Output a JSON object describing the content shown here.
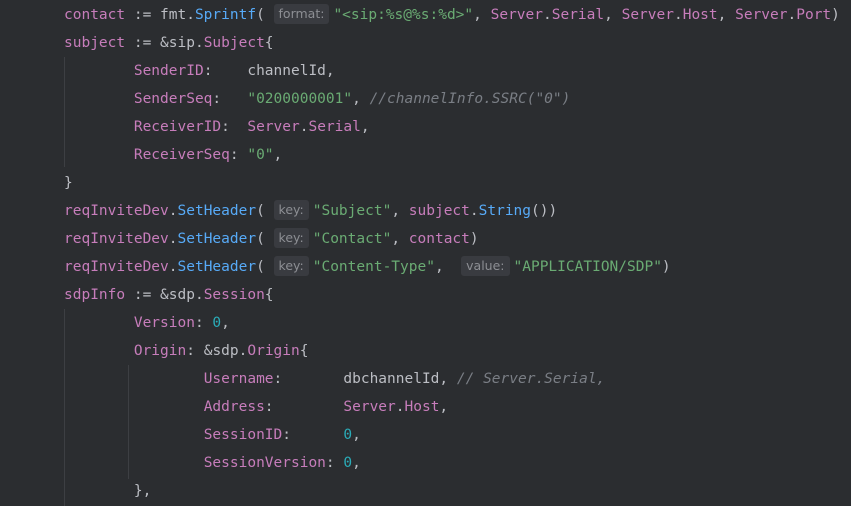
{
  "code_lines": [
    [
      {
        "c": "tk-var",
        "t": "contact"
      },
      {
        "c": "tk-op",
        "t": " := "
      },
      {
        "c": "tk-pkg",
        "t": "fmt."
      },
      {
        "c": "tk-fn",
        "t": "Sprintf"
      },
      {
        "c": "tk-punc",
        "t": "( "
      },
      {
        "c": "hint",
        "t": "format:"
      },
      {
        "c": "tk-str",
        "t": "\"<sip:%s@%s:%d>\""
      },
      {
        "c": "tk-punc",
        "t": ", "
      },
      {
        "c": "tk-var",
        "t": "Server"
      },
      {
        "c": "tk-punc",
        "t": "."
      },
      {
        "c": "tk-fld",
        "t": "Serial"
      },
      {
        "c": "tk-punc",
        "t": ", "
      },
      {
        "c": "tk-var",
        "t": "Server"
      },
      {
        "c": "tk-punc",
        "t": "."
      },
      {
        "c": "tk-fld",
        "t": "Host"
      },
      {
        "c": "tk-punc",
        "t": ", "
      },
      {
        "c": "tk-var",
        "t": "Server"
      },
      {
        "c": "tk-punc",
        "t": "."
      },
      {
        "c": "tk-fld",
        "t": "Port"
      },
      {
        "c": "tk-punc",
        "t": ")"
      }
    ],
    [
      {
        "c": "tk-var",
        "t": "subject"
      },
      {
        "c": "tk-op",
        "t": " := "
      },
      {
        "c": "tk-punc",
        "t": "&"
      },
      {
        "c": "tk-pkg",
        "t": "sip."
      },
      {
        "c": "tk-type",
        "t": "Subject"
      },
      {
        "c": "tk-punc",
        "t": "{"
      }
    ],
    [
      {
        "c": "tk-plain",
        "t": "        "
      },
      {
        "c": "tk-fld",
        "t": "SenderID"
      },
      {
        "c": "tk-punc",
        "t": ":    "
      },
      {
        "c": "tk-plain",
        "t": "channelId"
      },
      {
        "c": "tk-punc",
        "t": ","
      }
    ],
    [
      {
        "c": "tk-plain",
        "t": "        "
      },
      {
        "c": "tk-fld",
        "t": "SenderSeq"
      },
      {
        "c": "tk-punc",
        "t": ":   "
      },
      {
        "c": "tk-str",
        "t": "\"0200000001\""
      },
      {
        "c": "tk-punc",
        "t": ", "
      },
      {
        "c": "tk-cmt",
        "t": "//channelInfo.SSRC(\"0\")"
      }
    ],
    [
      {
        "c": "tk-plain",
        "t": "        "
      },
      {
        "c": "tk-fld",
        "t": "ReceiverID"
      },
      {
        "c": "tk-punc",
        "t": ":  "
      },
      {
        "c": "tk-var",
        "t": "Server"
      },
      {
        "c": "tk-punc",
        "t": "."
      },
      {
        "c": "tk-fld",
        "t": "Serial"
      },
      {
        "c": "tk-punc",
        "t": ","
      }
    ],
    [
      {
        "c": "tk-plain",
        "t": "        "
      },
      {
        "c": "tk-fld",
        "t": "ReceiverSeq"
      },
      {
        "c": "tk-punc",
        "t": ": "
      },
      {
        "c": "tk-str",
        "t": "\"0\""
      },
      {
        "c": "tk-punc",
        "t": ","
      }
    ],
    [
      {
        "c": "tk-punc",
        "t": "}"
      }
    ],
    [
      {
        "c": "tk-var",
        "t": "reqInviteDev"
      },
      {
        "c": "tk-punc",
        "t": "."
      },
      {
        "c": "tk-fn",
        "t": "SetHeader"
      },
      {
        "c": "tk-punc",
        "t": "( "
      },
      {
        "c": "hint",
        "t": "key:"
      },
      {
        "c": "tk-str",
        "t": "\"Subject\""
      },
      {
        "c": "tk-punc",
        "t": ", "
      },
      {
        "c": "tk-var",
        "t": "subject"
      },
      {
        "c": "tk-punc",
        "t": "."
      },
      {
        "c": "tk-fn",
        "t": "String"
      },
      {
        "c": "tk-punc",
        "t": "())"
      }
    ],
    [
      {
        "c": "tk-var",
        "t": "reqInviteDev"
      },
      {
        "c": "tk-punc",
        "t": "."
      },
      {
        "c": "tk-fn",
        "t": "SetHeader"
      },
      {
        "c": "tk-punc",
        "t": "( "
      },
      {
        "c": "hint",
        "t": "key:"
      },
      {
        "c": "tk-str",
        "t": "\"Contact\""
      },
      {
        "c": "tk-punc",
        "t": ", "
      },
      {
        "c": "tk-var",
        "t": "contact"
      },
      {
        "c": "tk-punc",
        "t": ")"
      }
    ],
    [
      {
        "c": "tk-var",
        "t": "reqInviteDev"
      },
      {
        "c": "tk-punc",
        "t": "."
      },
      {
        "c": "tk-fn",
        "t": "SetHeader"
      },
      {
        "c": "tk-punc",
        "t": "( "
      },
      {
        "c": "hint",
        "t": "key:"
      },
      {
        "c": "tk-str",
        "t": "\"Content-Type\""
      },
      {
        "c": "tk-punc",
        "t": ",  "
      },
      {
        "c": "hint",
        "t": "value:"
      },
      {
        "c": "tk-str",
        "t": "\"APPLICATION/SDP\""
      },
      {
        "c": "tk-punc",
        "t": ")"
      }
    ],
    [
      {
        "c": "tk-var",
        "t": "sdpInfo"
      },
      {
        "c": "tk-op",
        "t": " := "
      },
      {
        "c": "tk-punc",
        "t": "&"
      },
      {
        "c": "tk-pkg",
        "t": "sdp."
      },
      {
        "c": "tk-type",
        "t": "Session"
      },
      {
        "c": "tk-punc",
        "t": "{"
      }
    ],
    [
      {
        "c": "tk-plain",
        "t": "        "
      },
      {
        "c": "tk-fld",
        "t": "Version"
      },
      {
        "c": "tk-punc",
        "t": ": "
      },
      {
        "c": "tk-num",
        "t": "0"
      },
      {
        "c": "tk-punc",
        "t": ","
      }
    ],
    [
      {
        "c": "tk-plain",
        "t": "        "
      },
      {
        "c": "tk-fld",
        "t": "Origin"
      },
      {
        "c": "tk-punc",
        "t": ": &"
      },
      {
        "c": "tk-pkg",
        "t": "sdp."
      },
      {
        "c": "tk-type",
        "t": "Origin"
      },
      {
        "c": "tk-punc",
        "t": "{"
      }
    ],
    [
      {
        "c": "tk-plain",
        "t": "                "
      },
      {
        "c": "tk-fld",
        "t": "Username"
      },
      {
        "c": "tk-punc",
        "t": ":       "
      },
      {
        "c": "tk-plain",
        "t": "dbchannelId"
      },
      {
        "c": "tk-punc",
        "t": ", "
      },
      {
        "c": "tk-cmt",
        "t": "// Server.Serial,"
      }
    ],
    [
      {
        "c": "tk-plain",
        "t": "                "
      },
      {
        "c": "tk-fld",
        "t": "Address"
      },
      {
        "c": "tk-punc",
        "t": ":        "
      },
      {
        "c": "tk-var",
        "t": "Server"
      },
      {
        "c": "tk-punc",
        "t": "."
      },
      {
        "c": "tk-fld",
        "t": "Host"
      },
      {
        "c": "tk-punc",
        "t": ","
      }
    ],
    [
      {
        "c": "tk-plain",
        "t": "                "
      },
      {
        "c": "tk-fld",
        "t": "SessionID"
      },
      {
        "c": "tk-punc",
        "t": ":      "
      },
      {
        "c": "tk-num",
        "t": "0"
      },
      {
        "c": "tk-punc",
        "t": ","
      }
    ],
    [
      {
        "c": "tk-plain",
        "t": "                "
      },
      {
        "c": "tk-fld",
        "t": "SessionVersion"
      },
      {
        "c": "tk-punc",
        "t": ": "
      },
      {
        "c": "tk-num",
        "t": "0"
      },
      {
        "c": "tk-punc",
        "t": ","
      }
    ],
    [
      {
        "c": "tk-plain",
        "t": "        "
      },
      {
        "c": "tk-punc",
        "t": "},"
      }
    ]
  ]
}
